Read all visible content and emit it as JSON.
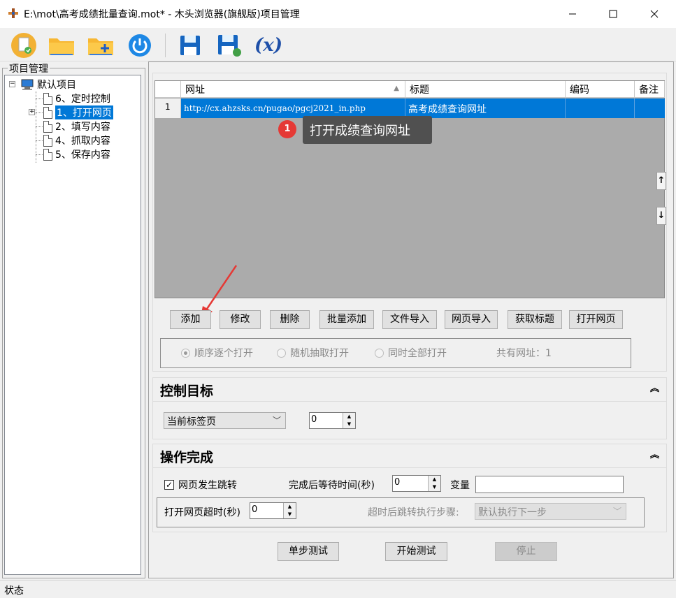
{
  "window": {
    "title": "E:\\mot\\高考成绩批量查询.mot* - 木头浏览器(旗舰版)项目管理",
    "minimize_icon": "minimize-icon",
    "maximize_icon": "maximize-icon",
    "close_icon": "close-icon"
  },
  "toolbar": {
    "buttons": [
      {
        "icon": "new-project-icon"
      },
      {
        "icon": "open-folder-icon"
      },
      {
        "icon": "add-folder-icon"
      },
      {
        "icon": "power-icon"
      },
      {
        "icon": "save-icon"
      },
      {
        "icon": "save-as-icon"
      },
      {
        "icon": "variable-icon",
        "label": "(x)"
      }
    ]
  },
  "project_panel": {
    "title": "项目管理",
    "root": "默认项目",
    "items": [
      {
        "label": "6、定时控制"
      },
      {
        "label": "1、打开网页",
        "selected": true
      },
      {
        "label": "2、填写内容"
      },
      {
        "label": "4、抓取内容"
      },
      {
        "label": "5、保存内容"
      }
    ]
  },
  "url_grid": {
    "columns": [
      "网址",
      "标题",
      "编码",
      "备注"
    ],
    "rows": [
      {
        "index": "1",
        "url": "http://cx.ahzsks.cn/pugao/pgcj2021_in.php",
        "title": "高考成绩查询网址",
        "encoding": "",
        "note": ""
      }
    ],
    "scroll_up": "↑",
    "scroll_down": "↓"
  },
  "tooltip": {
    "badge": "1",
    "text": "打开成绩查询网址"
  },
  "url_buttons": [
    "添加",
    "修改",
    "删除",
    "批量添加",
    "文件导入",
    "网页导入",
    "获取标题",
    "打开网页"
  ],
  "open_mode": {
    "options": [
      "顺序逐个打开",
      "随机抽取打开",
      "同时全部打开"
    ],
    "selected": "顺序逐个打开",
    "count_label": "共有网址：1"
  },
  "control_target": {
    "title": "控制目标",
    "collapse_icon": "double-chevron-up-icon",
    "tab_select": "当前标签页",
    "tab_index": "0"
  },
  "operation_done": {
    "title": "操作完成",
    "page_jump_label": "网页发生跳转",
    "page_jump_checked": true,
    "wait_label": "完成后等待时间(秒)",
    "wait_value": "0",
    "variable_label": "变量",
    "variable_value": "",
    "timeout_label": "打开网页超时(秒)",
    "timeout_value": "0",
    "timeout_step_label": "超时后跳转执行步骤:",
    "timeout_step_value": "默认执行下一步"
  },
  "test_buttons": {
    "step": "单步测试",
    "start": "开始测试",
    "stop": "停止"
  },
  "status": "状态",
  "colors": {
    "selection": "#0078d7",
    "grid_bg": "#ababab",
    "tooltip_bg": "#505050",
    "badge": "#e53935",
    "arrow": "#e53935"
  }
}
